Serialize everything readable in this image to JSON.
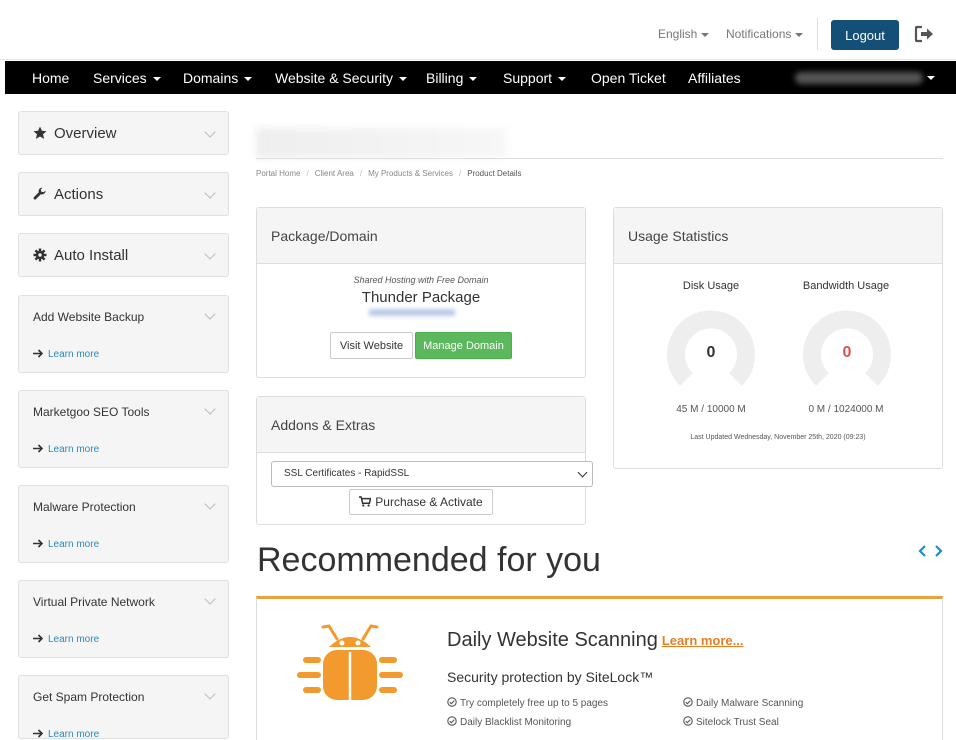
{
  "topbar": {
    "language": "English",
    "notifications": "Notifications",
    "logout": "Logout"
  },
  "nav": {
    "items": [
      {
        "label": "Home",
        "dropdown": false
      },
      {
        "label": "Services",
        "dropdown": true
      },
      {
        "label": "Domains",
        "dropdown": true
      },
      {
        "label": "Website & Security",
        "dropdown": true
      },
      {
        "label": "Billing",
        "dropdown": true
      },
      {
        "label": "Support",
        "dropdown": true
      },
      {
        "label": "Open Ticket",
        "dropdown": false
      },
      {
        "label": "Affiliates",
        "dropdown": false
      }
    ]
  },
  "sidebar": {
    "panels": [
      {
        "label": "Overview",
        "icon": "star-icon"
      },
      {
        "label": "Actions",
        "icon": "wrench-icon"
      },
      {
        "label": "Auto Install",
        "icon": "gear-icon"
      }
    ],
    "promos": [
      {
        "label": "Add Website Backup",
        "link": "Learn more"
      },
      {
        "label": "Marketgoo SEO Tools",
        "link": "Learn more"
      },
      {
        "label": "Malware Protection",
        "link": "Learn more"
      },
      {
        "label": "Virtual Private Network",
        "link": "Learn more"
      },
      {
        "label": "Get Spam Protection",
        "link": "Learn more"
      }
    ]
  },
  "breadcrumb": [
    "Portal Home",
    "Client Area",
    "My Products & Services",
    "Product Details"
  ],
  "package": {
    "title": "Package/Domain",
    "subtitle": "Shared Hosting with Free Domain",
    "name": "Thunder Package",
    "visit_label": "Visit Website",
    "manage_label": "Manage Domain"
  },
  "addons": {
    "title": "Addons & Extras",
    "selected": "SSL Certificates - RapidSSL",
    "purchase_label": "Purchase & Activate"
  },
  "usage": {
    "title": "Usage Statistics",
    "disk": {
      "label": "Disk Usage",
      "value": "0",
      "detail": "45 M / 10000 M",
      "color": "#333333"
    },
    "bandwidth": {
      "label": "Bandwidth Usage",
      "value": "0",
      "detail": "0 M / 1024000 M",
      "color": "#d9534f"
    },
    "last_updated": "Last Updated Wednesday, November 25th, 2020 (09:23)"
  },
  "recommended": {
    "heading": "Recommended for you",
    "title": "Daily Website Scanning",
    "learn_more": "Learn more...",
    "subtitle": "Security protection by SiteLock™",
    "features": [
      "Try completely free up to 5 pages",
      "Daily Malware Scanning",
      "Daily Blacklist Monitoring",
      "Sitelock Trust Seal"
    ],
    "accent": "#f39a2e"
  }
}
